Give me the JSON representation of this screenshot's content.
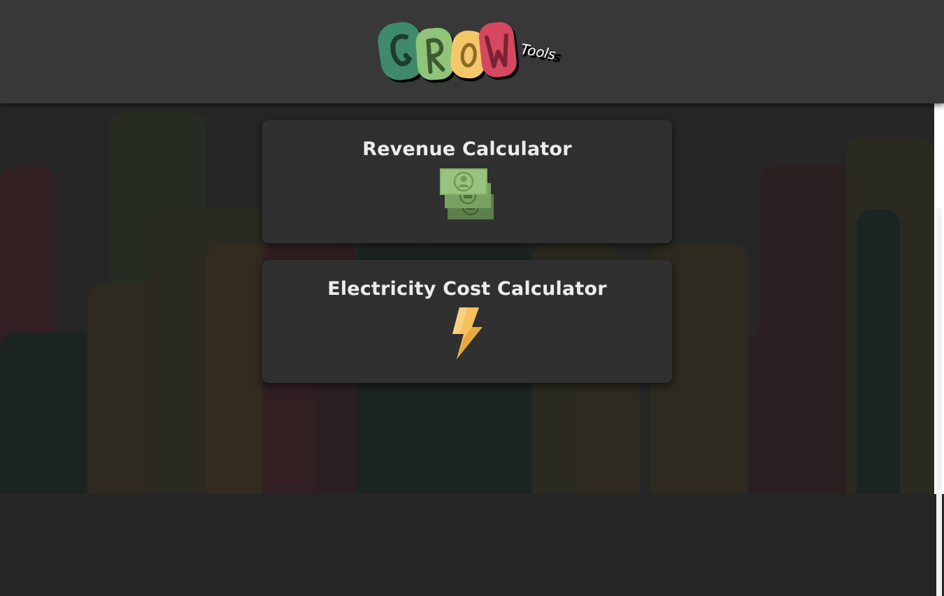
{
  "header": {
    "logo_text": "GROW",
    "logo_subtext": "Tools",
    "colors": {
      "background": "#383838",
      "green_dark": "#3f8a6b",
      "green_light": "#8fc479",
      "yellow": "#f4c86a",
      "red": "#d64760"
    }
  },
  "cards": [
    {
      "title": "Revenue Calculator",
      "icon": "money-stack-icon"
    },
    {
      "title": "Electricity Cost Calculator",
      "icon": "lightning-bolt-icon"
    }
  ],
  "colors": {
    "page_background": "#262626",
    "card_background": "#303030",
    "card_text": "#ececec",
    "bolt": "#f6c05e"
  }
}
